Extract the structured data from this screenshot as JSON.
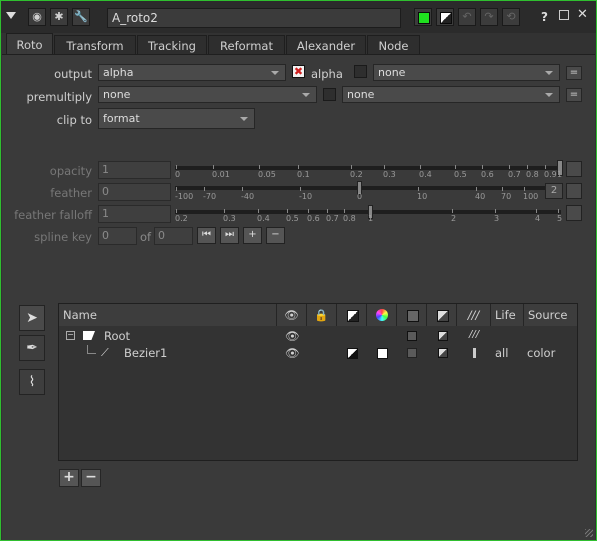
{
  "header": {
    "node_name": "A_roto2",
    "help_label": "?"
  },
  "tabs": [
    {
      "label": "Roto"
    },
    {
      "label": "Transform"
    },
    {
      "label": "Tracking"
    },
    {
      "label": "Reformat"
    },
    {
      "label": "Alexander"
    },
    {
      "label": "Node"
    }
  ],
  "params": {
    "output_label": "output",
    "output_value": "alpha",
    "output_check_label": "alpha",
    "output_extra": "none",
    "premultiply_label": "premultiply",
    "premultiply_value": "none",
    "premultiply_extra": "none",
    "clipto_label": "clip to",
    "clipto_value": "format",
    "eq_label": "=",
    "opacity_label": "opacity",
    "opacity_value": "1",
    "feather_label": "feather",
    "feather_value": "0",
    "feather_side": "2",
    "falloff_label": "feather falloff",
    "falloff_value": "1",
    "splinekey_label": "spline key",
    "splinekey_value": "0",
    "splinekey_of": "of",
    "splinekey_total": "0"
  },
  "sliders": {
    "opacity_ticks": [
      "0",
      "0.01",
      "0.05",
      "0.1",
      "0.2",
      "0.3",
      "0.4",
      "0.5",
      "0.6",
      "0.7",
      "0.8",
      "0.9",
      "1"
    ],
    "feather_ticks": [
      "-100",
      "-70",
      "-40",
      "-10",
      "0",
      "10",
      "40",
      "70",
      "100"
    ],
    "falloff_ticks": [
      "0.2",
      "0.3",
      "0.4",
      "0.5",
      "0.6",
      "0.7",
      "0.8",
      "1",
      "2",
      "3",
      "4",
      "5"
    ],
    "opacity_level": 1.0,
    "feather_level": 0.0,
    "falloff_level": 1.0
  },
  "tree": {
    "columns": [
      "Name",
      "",
      "",
      "",
      "",
      "",
      "",
      "",
      "Life",
      "Source"
    ],
    "root_label": "Root",
    "child_label": "Bezier1",
    "child_life": "all",
    "child_source": "color"
  },
  "buttons": {
    "add": "+",
    "remove": "−"
  }
}
